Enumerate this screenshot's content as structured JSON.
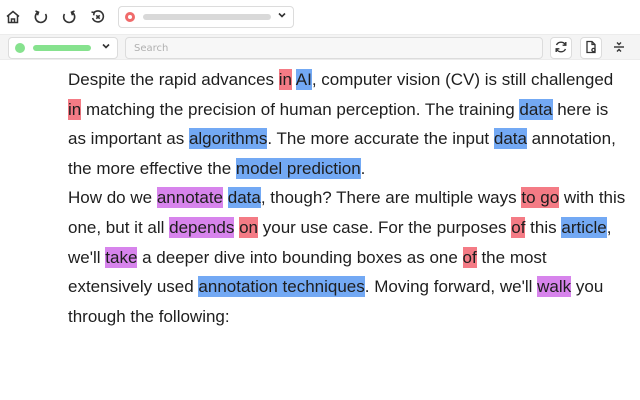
{
  "toolbar": {
    "search_placeholder": "Search"
  },
  "colors": {
    "red_highlight": "#f47b85",
    "blue_highlight": "#73a9f4",
    "purple_highlight": "#d784ec",
    "status_red": "#f06b6b",
    "status_green": "#86e28e"
  },
  "icons": [
    "home-icon",
    "undo-icon",
    "redo-icon",
    "history-icon",
    "chevron-down-icon",
    "refresh-icon",
    "document-settings-icon",
    "collapse-icon"
  ],
  "text": {
    "t1": "Despite the rapid advances ",
    "t2": "in",
    "t3": " ",
    "t4": "AI",
    "t5": ", computer vision (CV) is still challenged ",
    "t6": "in",
    "t7": " matching the precision of human perception. The training ",
    "t8": "data",
    "t9": " here is as important as ",
    "t10": "algorithms",
    "t11": ". The more accurate the input ",
    "t12": "data",
    "t13": " annotation, the more effective the ",
    "t14": "model prediction",
    "t15": ".",
    "t16": "How do we ",
    "t17": "annotate",
    "t18": " ",
    "t19": "data",
    "t20": ", though? There are multiple ways ",
    "t21": "to go",
    "t22": " with this one, but it all ",
    "t23": "depends",
    "t24": " ",
    "t25": "on",
    "t26": " your use case. For the purposes ",
    "t27": "of",
    "t28": " this ",
    "t29": "article",
    "t30": ", we'll ",
    "t31": "take",
    "t32": " a deeper dive into bounding boxes as one ",
    "t33": "of",
    "t34": " the most extensively used ",
    "t35": "annotation techniques",
    "t36": ". Moving forward, we'll ",
    "t37": "walk",
    "t38": " you through the following:"
  }
}
